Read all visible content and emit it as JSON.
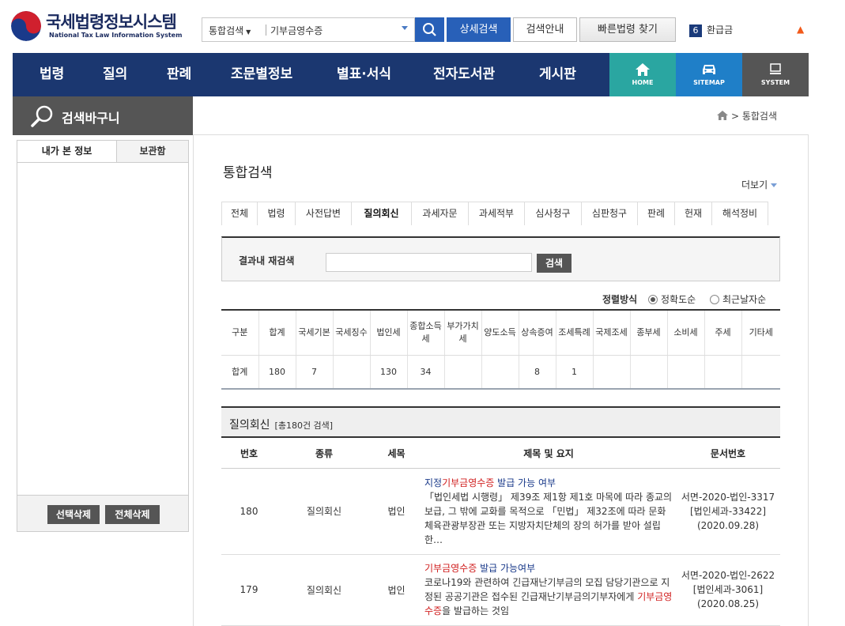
{
  "header": {
    "logo_ko": "국세법령정보시스템",
    "logo_en": "National Tax Law Information System",
    "search_category": "통합검색",
    "search_value": "기부금영수증",
    "btn_detail": "상세검색",
    "btn_guide": "검색안내",
    "btn_quick": "빠른법령 찾기",
    "rank_num": "6",
    "rank_text": "환급금",
    "rank_arrow": "▲"
  },
  "nav": {
    "items": [
      "법령",
      "질의",
      "판례",
      "조문별정보",
      "별표·서식",
      "전자도서관",
      "게시판"
    ],
    "home": "HOME",
    "sitemap": "SITEMAP",
    "system": "SYSTEM",
    "colors": {
      "bar": "#1b3770",
      "home": "#2aa6a1",
      "sitemap": "#1f7fc8",
      "system": "#555555"
    }
  },
  "sidebar": {
    "title": "검색바구니",
    "tab_viewed": "내가 본 정보",
    "tab_saved": "보관함",
    "btn_delete_selected": "선택삭제",
    "btn_delete_all": "전체삭제"
  },
  "breadcrumb": {
    "current": "통합검색"
  },
  "page": {
    "title": "통합검색",
    "more": "더보기",
    "tabs": [
      "전체",
      "법령",
      "사전답변",
      "질의회신",
      "과세자문",
      "과세적부",
      "심사청구",
      "심판청구",
      "판례",
      "헌재",
      "해석정비"
    ],
    "active_tab": "질의회신"
  },
  "research": {
    "label": "결과내 재검색",
    "value": "",
    "button": "검색"
  },
  "sort": {
    "label": "정렬방식",
    "options": [
      "정확도순",
      "최근날자순"
    ],
    "selected": "정확도순"
  },
  "stats": {
    "headers": [
      "구분",
      "합계",
      "국세기본",
      "국세징수",
      "법인세",
      "종합소득세",
      "부가가치세",
      "양도소득",
      "상속증여",
      "조세특례",
      "국제조세",
      "종부세",
      "소비세",
      "주세",
      "기타세"
    ],
    "values": [
      "합계",
      "180",
      "7",
      "",
      "130",
      "34",
      "",
      "",
      "8",
      "1",
      "",
      "",
      "",
      "",
      ""
    ]
  },
  "results": {
    "section_title": "질의회신",
    "count_text": "[총180건 검색]",
    "columns": [
      "번호",
      "종류",
      "세목",
      "제목 및 요지",
      "문서번호"
    ],
    "rows": [
      {
        "no": "180",
        "kind": "질의회신",
        "tax": "법인",
        "title_pre": "지정",
        "title_hl": "기부금영수증",
        "title_post": " 발급 가능 여부",
        "summary_pre": "「법인세법 시행령」 제39조 제1항 제1호 마목에 따라 종교의 보급, 그 밖에 교화를 목적으로 「민법」 제32조에 따라 문화체육관광부장관 또는 지방자치단체의 장의 허가를 받아 설립한…",
        "summary_hl": "",
        "summary_post": "",
        "doc_no": "서면-2020-법인-3317",
        "doc_ref": "[법인세과-33422]",
        "doc_date": "(2020.09.28)"
      },
      {
        "no": "179",
        "kind": "질의회신",
        "tax": "법인",
        "title_pre": "",
        "title_hl": "기부금영수증",
        "title_post": " 발급 가능여부",
        "summary_pre": "코로나19와 관련하여 긴급재난기부금의 모집 담당기관으로 지정된 공공기관은 접수된 긴급재난기부금의기부자에게 ",
        "summary_hl": "기부금영수증",
        "summary_post": "을 발급하는 것임",
        "doc_no": "서면-2020-법인-2622",
        "doc_ref": "[법인세과-3061]",
        "doc_date": "(2020.08.25)"
      }
    ]
  }
}
